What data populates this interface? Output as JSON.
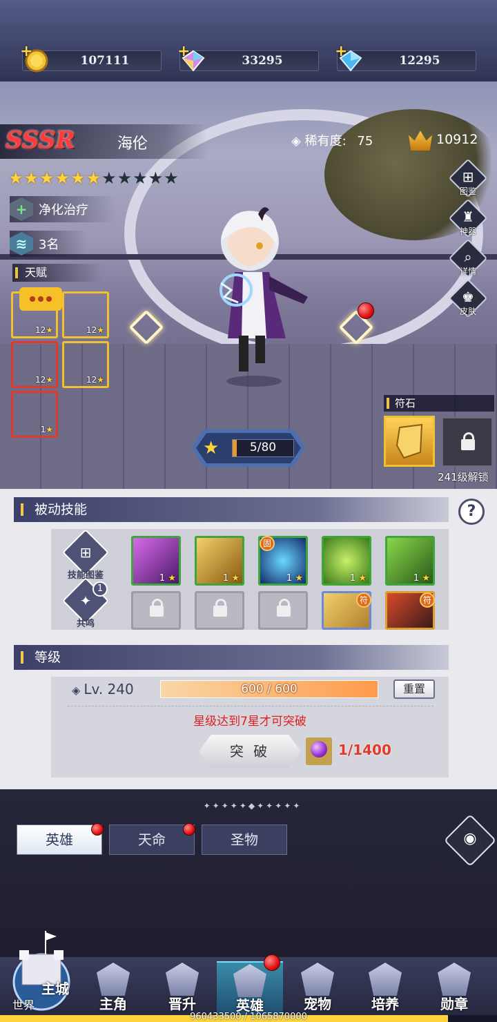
{
  "resources": [
    {
      "icon": "gold-coin-icon",
      "value": "107111"
    },
    {
      "icon": "rainbow-diamond-icon",
      "value": "33295"
    },
    {
      "icon": "blue-diamond-icon",
      "value": "12295"
    }
  ],
  "hero": {
    "rarity_tag": "SSSR",
    "name": "海伦",
    "stars_filled": 6,
    "stars_total": 11,
    "role": "净化治疗",
    "rank": "3名",
    "rarity_label": "稀有度:",
    "rarity_value": "75",
    "power": "10912"
  },
  "side_buttons": [
    "图鉴",
    "神器",
    "详情",
    "皮肤"
  ],
  "talent": {
    "label": "天赋",
    "cards": [
      {
        "level": "12",
        "color": "#2a8c7a"
      },
      {
        "level": "12",
        "color": "#4aa83a"
      },
      {
        "level": "12",
        "color": "#6a4cc0"
      },
      {
        "level": "12",
        "color": "#2a6ab0"
      },
      {
        "level": "1",
        "color": "#b83a2a"
      }
    ]
  },
  "star_progress": {
    "text": "5/80",
    "current": 5,
    "max": 80
  },
  "rune": {
    "label": "符石",
    "unlock_text": "241级解锁"
  },
  "passive": {
    "title": "被动技能",
    "help": "?",
    "buttons": [
      "技能图鉴",
      "共鸣"
    ],
    "resonance_badge": "1",
    "skills": [
      {
        "level": "1",
        "color": "#8a2ab0"
      },
      {
        "level": "1",
        "color": "#b88a20"
      },
      {
        "level": "1",
        "color": "#1e4a9a",
        "badge": "固"
      },
      {
        "level": "1",
        "color": "#5aa82a"
      },
      {
        "level": "1",
        "color": "#3a8a2a"
      }
    ],
    "extra_badges": [
      "符",
      "符"
    ]
  },
  "level": {
    "title": "等级",
    "lv_text": "Lv. 240",
    "xp_text": "600 / 600",
    "xp_fraction": 1.0,
    "reset": "重置",
    "warning": "星级达到7星才可突破",
    "breakthrough": "突 破",
    "cost": "1/1400"
  },
  "tabs": [
    {
      "label": "英雄",
      "active": true,
      "dot": true
    },
    {
      "label": "天命",
      "active": false,
      "dot": true
    },
    {
      "label": "圣物",
      "active": false,
      "dot": false
    }
  ],
  "nav": {
    "city": "主城",
    "world": "世界",
    "items": [
      {
        "label": "主角",
        "active": false
      },
      {
        "label": "晋升",
        "active": false
      },
      {
        "label": "英雄",
        "active": true
      },
      {
        "label": "宠物",
        "active": false
      },
      {
        "label": "培养",
        "active": false
      },
      {
        "label": "勋章",
        "active": false
      }
    ]
  },
  "exp_footer": "960433500 / 1065870000",
  "exp_fraction": 0.901
}
